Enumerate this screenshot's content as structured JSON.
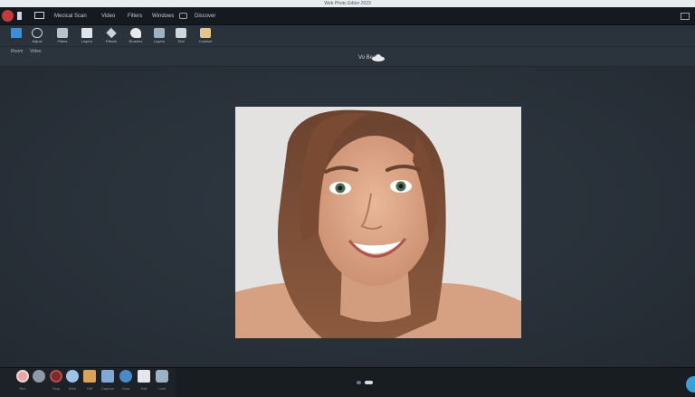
{
  "window": {
    "title": "Web Photo Editor 2023"
  },
  "menu": {
    "items": [
      "Mecical Scan",
      "Video",
      "Filters",
      "Windows",
      "Discover"
    ]
  },
  "toolbar": {
    "tools": [
      {
        "icon": "document-icon",
        "label": ""
      },
      {
        "icon": "adjust-icon",
        "label": "Adjust"
      },
      {
        "icon": "filters-icon",
        "label": "Filters"
      },
      {
        "icon": "layers-icon",
        "label": "Layers"
      },
      {
        "icon": "effects-icon",
        "label": "Effects"
      },
      {
        "icon": "brush-icon",
        "label": "Brushes"
      },
      {
        "icon": "layers-stack-icon",
        "label": "Layers"
      },
      {
        "icon": "text-icon",
        "label": "Text"
      },
      {
        "icon": "palette-icon",
        "label": "Colorize"
      }
    ]
  },
  "subbar": {
    "tabs": [
      "Room",
      "Video"
    ],
    "center_title": "Vo Beam"
  },
  "dock": {
    "items": [
      {
        "icon": "record-icon",
        "label": "Rec"
      },
      {
        "icon": "sphere-icon",
        "label": ""
      },
      {
        "icon": "stop-icon",
        "label": "Stop"
      },
      {
        "icon": "globe-icon",
        "label": "Web"
      },
      {
        "icon": "gift-icon",
        "label": "Giff"
      },
      {
        "icon": "cube-icon",
        "label": "Capture"
      },
      {
        "icon": "gear-icon",
        "label": "Gear"
      },
      {
        "icon": "person-icon",
        "label": "Edit"
      },
      {
        "icon": "leaf-icon",
        "label": "Leaf"
      }
    ]
  },
  "colors": {
    "accent": "#3aa0d8",
    "background": "#2a323b",
    "menubar": "#151a20"
  }
}
